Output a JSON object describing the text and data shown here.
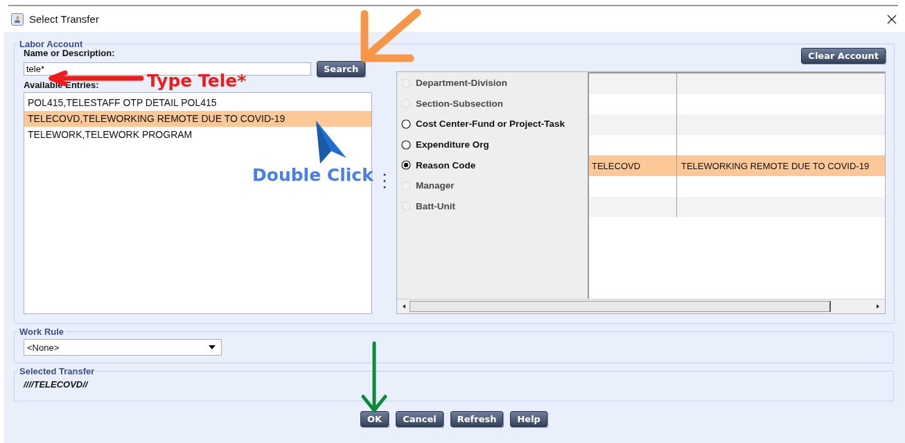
{
  "window": {
    "title": "Select Transfer"
  },
  "labor_account": {
    "legend": "Labor Account",
    "name_label": "Name or Description:",
    "name_field": {
      "value": "tele*"
    },
    "search_button": "Search",
    "entries_label": "Available Entries:",
    "entries": [
      {
        "text": "POL415,TELESTAFF OTP DETAIL POL415",
        "selected": false
      },
      {
        "text": "TELECOVD,TELEWORKING REMOTE DUE TO COVID-19",
        "selected": true
      },
      {
        "text": "TELEWORK,TELEWORK PROGRAM",
        "selected": false
      }
    ],
    "clear_button": "Clear Account",
    "levels": [
      {
        "label": "Department-Division",
        "disabled": true,
        "selected": false
      },
      {
        "label": "Section-Subsection",
        "disabled": true,
        "selected": false
      },
      {
        "label": "Cost Center-Fund or Project-Task",
        "disabled": false,
        "selected": false
      },
      {
        "label": "Expenditure Org",
        "disabled": false,
        "selected": false
      },
      {
        "label": "Reason Code",
        "disabled": false,
        "selected": true
      },
      {
        "label": "Manager",
        "disabled": true,
        "selected": false
      },
      {
        "label": "Batt-Unit",
        "disabled": true,
        "selected": false
      }
    ],
    "table": {
      "rows": [
        {
          "selected": false
        },
        {
          "selected": false
        },
        {
          "selected": false
        },
        {
          "selected": false
        },
        {
          "selected": true,
          "code": "TELECOVD",
          "description": "TELEWORKING REMOTE DUE TO COVID-19"
        },
        {
          "selected": false
        },
        {
          "selected": false
        }
      ]
    }
  },
  "work_rule": {
    "legend": "Work Rule",
    "value": "<None>"
  },
  "selected_transfer": {
    "legend": "Selected Transfer",
    "value": "////TELECOVD//"
  },
  "buttons": [
    {
      "label": "OK"
    },
    {
      "label": "Cancel"
    },
    {
      "label": "Refresh"
    },
    {
      "label": "Help"
    }
  ],
  "annotations": [
    {
      "kind": "arrow-down-left",
      "color": "#f79646"
    },
    {
      "kind": "arrow-left",
      "color": "#ee1c1c"
    },
    {
      "kind": "label",
      "text": "Type Tele*",
      "color": "#ee1c1c"
    },
    {
      "kind": "cursor",
      "color": "#1f6fd0"
    },
    {
      "kind": "label",
      "text": "Double Click",
      "color": "#4a7fe8"
    },
    {
      "kind": "arrow-down",
      "color": "#0a8a3a"
    }
  ]
}
